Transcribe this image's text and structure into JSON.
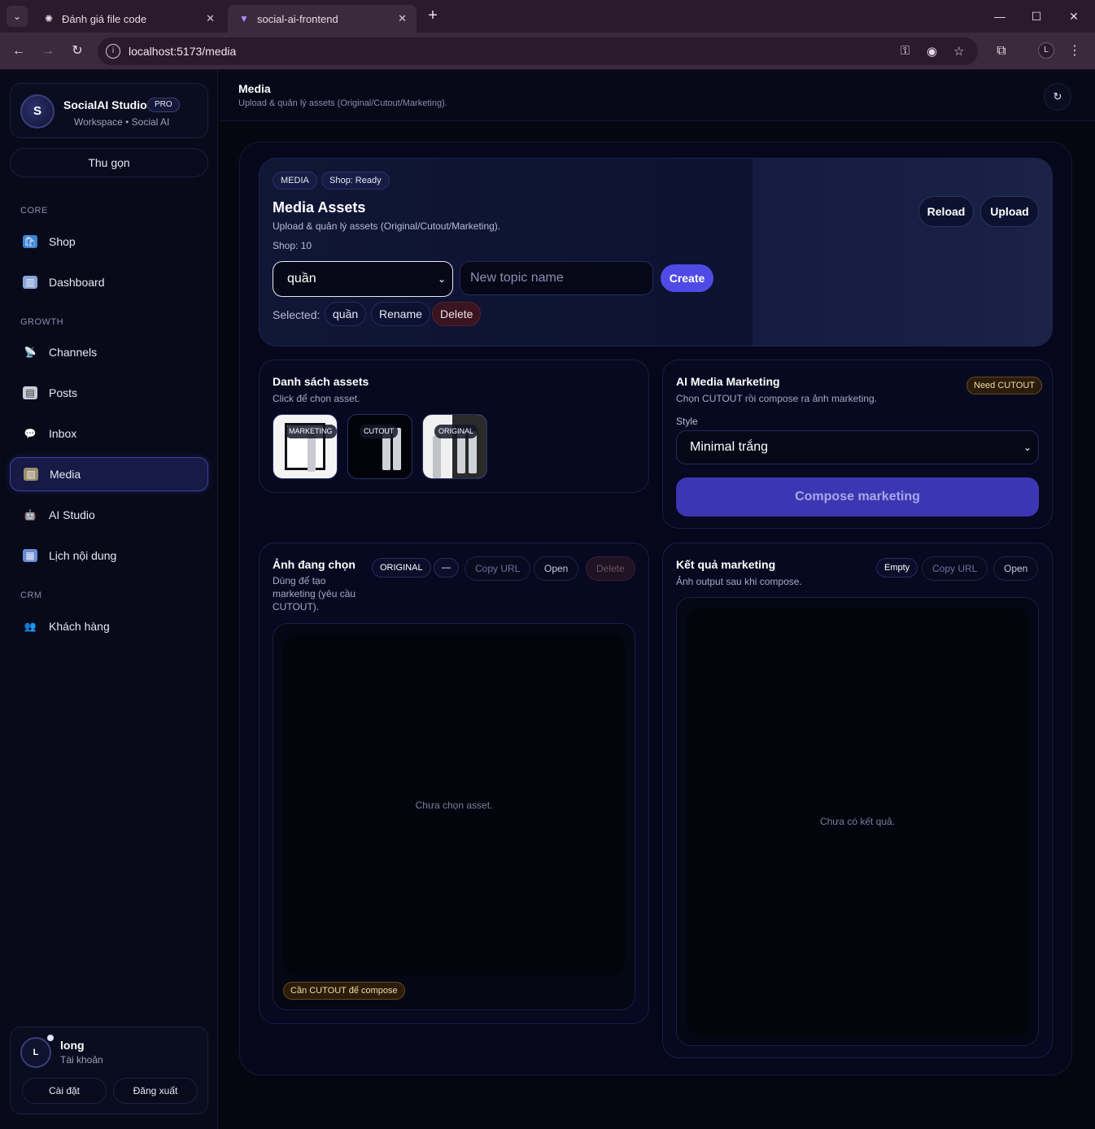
{
  "browser": {
    "tabs": [
      {
        "label": "Đánh giá file code",
        "icon": "openai-icon"
      },
      {
        "label": "social-ai-frontend",
        "icon": "vite-icon"
      }
    ],
    "url": "localhost:5173/media",
    "profile_initial": "L"
  },
  "sidebar": {
    "brand_title": "SocialAI Studio",
    "brand_badge": "PRO",
    "brand_sub": "Workspace • Social AI",
    "brand_logo": "S",
    "collapse_label": "Thu gọn",
    "sections": [
      {
        "label": "CORE",
        "items": [
          {
            "label": "Shop",
            "icon": "shop-icon"
          },
          {
            "label": "Dashboard",
            "icon": "dashboard-icon"
          }
        ]
      },
      {
        "label": "GROWTH",
        "items": [
          {
            "label": "Channels",
            "icon": "channels-icon"
          },
          {
            "label": "Posts",
            "icon": "posts-icon"
          },
          {
            "label": "Inbox",
            "icon": "inbox-icon"
          },
          {
            "label": "Media",
            "icon": "media-icon",
            "active": true
          },
          {
            "label": "AI Studio",
            "icon": "ai-studio-icon"
          },
          {
            "label": "Lịch nội dung",
            "icon": "calendar-icon"
          }
        ]
      },
      {
        "label": "CRM",
        "items": [
          {
            "label": "Khách hàng",
            "icon": "customers-icon"
          }
        ]
      }
    ],
    "user": {
      "initial": "L",
      "name": "long",
      "role": "Tài khoản",
      "settings_label": "Cài đặt",
      "logout_label": "Đăng xuất"
    }
  },
  "header": {
    "title": "Media",
    "subtitle": "Upload & quản lý assets (Original/Cutout/Marketing)."
  },
  "hero": {
    "pill_media": "MEDIA",
    "pill_shop": "Shop: Ready",
    "title": "Media Assets",
    "subtitle": "Upload & quản lý assets (Original/Cutout/Marketing).",
    "shop_line": "Shop: 10",
    "reload_label": "Reload",
    "upload_label": "Upload",
    "topic_selected": "quần",
    "topic_placeholder": "New topic name",
    "create_label": "Create",
    "selected_label": "Selected:",
    "selected_value": "quần",
    "rename_label": "Rename",
    "delete_label": "Delete"
  },
  "assets": {
    "title": "Danh sách assets",
    "subtitle": "Click để chọn asset.",
    "thumbs": [
      {
        "tag": "MARKETING"
      },
      {
        "tag": "CUTOUT"
      },
      {
        "tag": "ORIGINAL"
      }
    ]
  },
  "ai_marketing": {
    "title": "AI Media Marketing",
    "subtitle": "Chọn CUTOUT rồi compose ra ảnh marketing.",
    "badge": "Need CUTOUT",
    "style_label": "Style",
    "style_value": "Minimal trắng",
    "compose_label": "Compose marketing"
  },
  "selected_image": {
    "title": "Ảnh đang chọn",
    "subtitle": "Dùng để tạo marketing (yêu cầu CUTOUT).",
    "kind_pill": "ORIGINAL",
    "dash_pill": "—",
    "copy_label": "Copy URL",
    "open_label": "Open",
    "delete_label": "Delete",
    "empty_text": "Chưa chọn asset.",
    "warn": "Cần CUTOUT để compose"
  },
  "result": {
    "title": "Kết quả marketing",
    "subtitle": "Ảnh output sau khi compose.",
    "status_pill": "Empty",
    "copy_label": "Copy URL",
    "open_label": "Open",
    "empty_text": "Chưa có kết quả."
  }
}
